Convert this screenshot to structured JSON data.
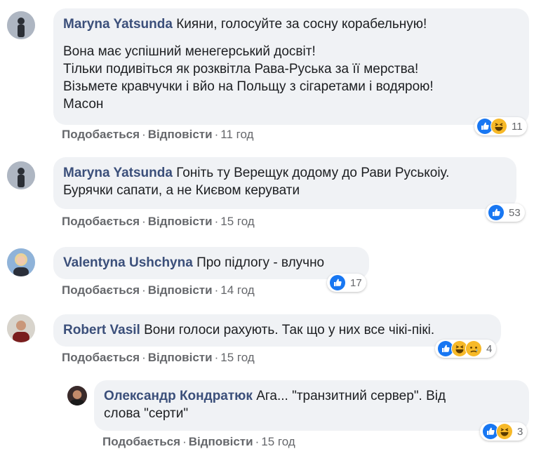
{
  "comments": [
    {
      "author": "Maryna Yatsunda",
      "paragraphs": [
        "Кияни, голосуйте за сосну корабельную!",
        "Вона має успішний менегерський досвіт!\nТільки подивіться як розквітла Рава-Руська за її мерства!\nВізьмете кравчучки і вйо на Польщу з сігаретами і водярою!\nМасон"
      ],
      "like_label": "Подобається",
      "reply_label": "Відповісти",
      "time": "11 год",
      "reaction_icons": [
        "like-icon",
        "haha-icon"
      ],
      "reaction_count": "11"
    },
    {
      "author": "Maryna Yatsunda",
      "paragraphs": [
        "Гоніть ту Верещук додому до Рави Руськоіу.\nБурячки сапати, а не Києвом керувати"
      ],
      "like_label": "Подобається",
      "reply_label": "Відповісти",
      "time": "15 год",
      "reaction_icons": [
        "like-icon"
      ],
      "reaction_count": "53"
    },
    {
      "author": "Valentyna Ushchyna",
      "paragraphs": [
        "Про підлогу - влучно"
      ],
      "like_label": "Подобається",
      "reply_label": "Відповісти",
      "time": "14 год",
      "reaction_icons": [
        "like-icon"
      ],
      "reaction_count": "17"
    },
    {
      "author": "Robert Vasil",
      "paragraphs": [
        "Вони голоси рахують. Так що у них все чікі-пікі."
      ],
      "like_label": "Подобається",
      "reply_label": "Відповісти",
      "time": "15 год",
      "reaction_icons": [
        "like-icon",
        "haha-icon",
        "sad-icon"
      ],
      "reaction_count": "4"
    },
    {
      "author": "Олександр Кондратюк",
      "paragraphs": [
        "Ага... \"транзитний сервер\". Від\nслова \"серти\""
      ],
      "like_label": "Подобається",
      "reply_label": "Відповісти",
      "time": "15 год",
      "reaction_icons": [
        "like-icon",
        "haha-icon"
      ],
      "reaction_count": "3"
    }
  ],
  "colors": {
    "bubble_bg": "#f0f2f5",
    "author": "#3b4f7a",
    "meta": "#65676b",
    "like_blue": "#1877f2",
    "haha_yellow": "#f7b928"
  }
}
